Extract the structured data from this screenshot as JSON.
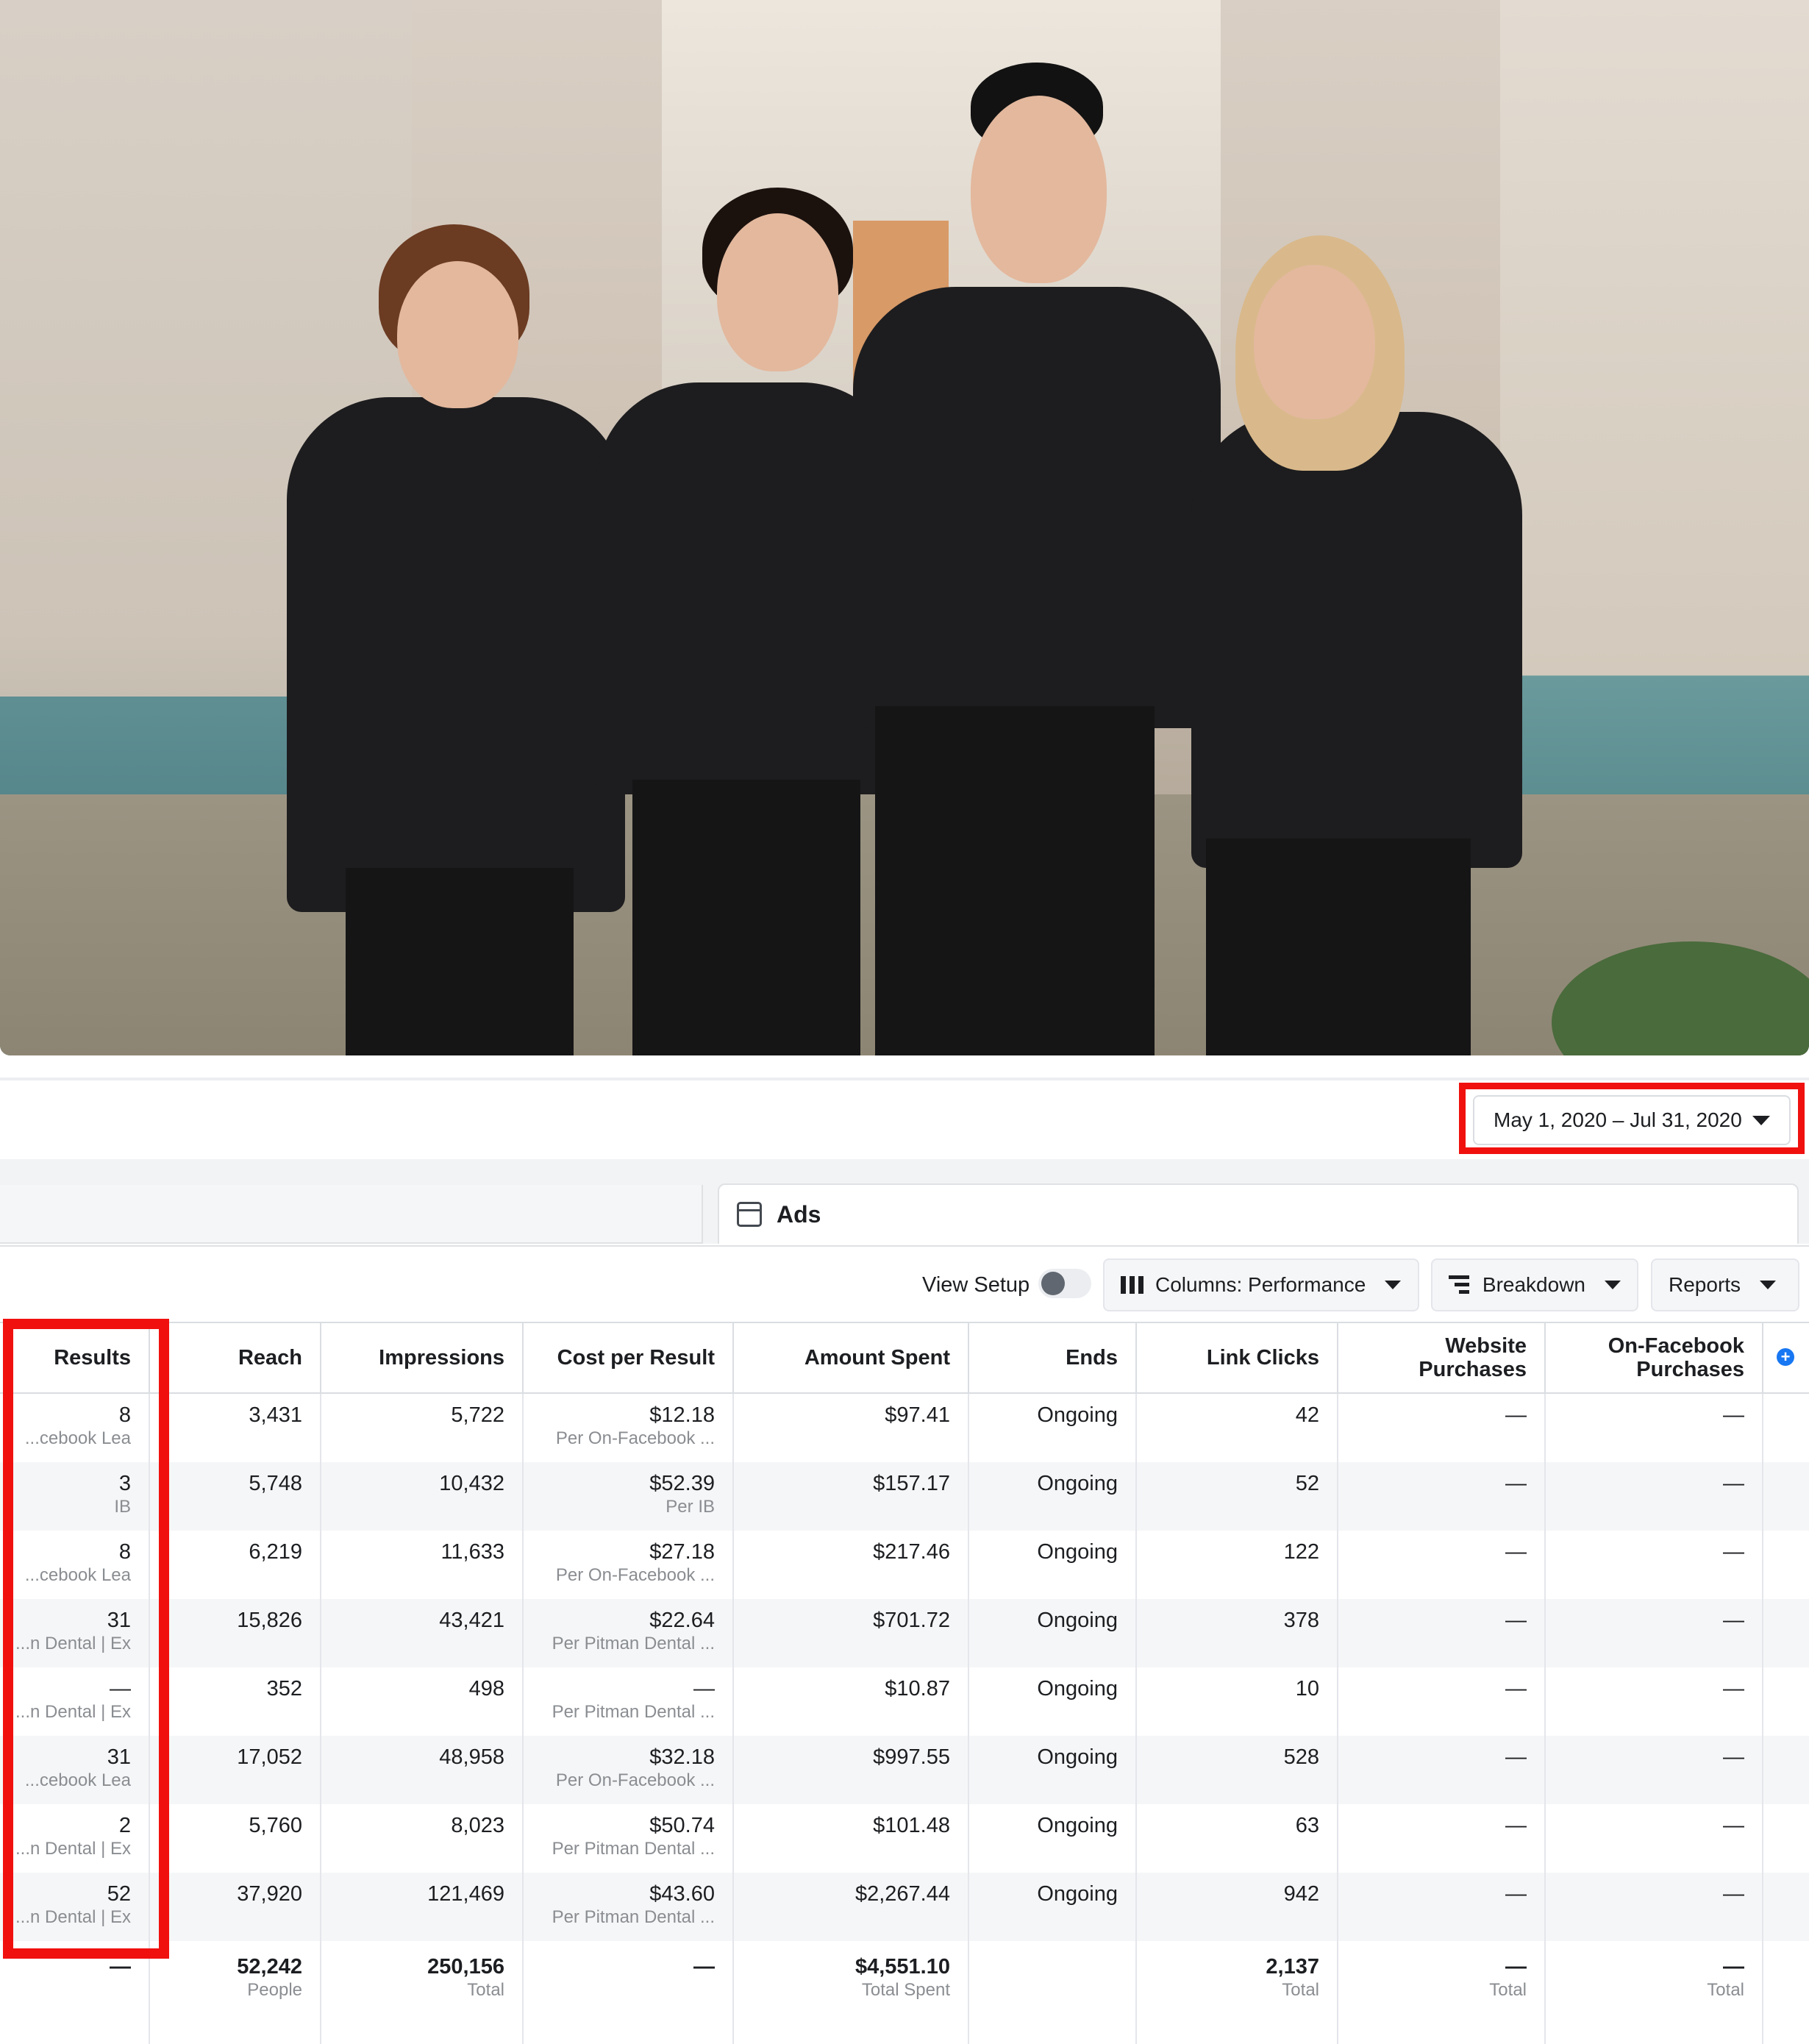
{
  "date_range": {
    "label": "May 1, 2020 – Jul 31, 2020"
  },
  "ads_panel": {
    "label": "Ads"
  },
  "controls": {
    "view_setup": "View Setup",
    "columns": "Columns: Performance",
    "breakdown": "Breakdown",
    "reports": "Reports"
  },
  "table": {
    "columns": [
      "Results",
      "Reach",
      "Impressions",
      "Cost per Result",
      "Amount Spent",
      "Ends",
      "Link Clicks",
      "Website Purchases",
      "On-Facebook Purchases"
    ],
    "rows": [
      {
        "results": "8",
        "results_sub": "cebook Lea...",
        "reach": "3,431",
        "impressions": "5,722",
        "cost": "$12.18",
        "cost_sub": "Per On-Facebook ...",
        "spent": "$97.41",
        "ends": "Ongoing",
        "clicks": "42",
        "web": "—",
        "onfb": "—"
      },
      {
        "results": "3",
        "results_sub": "IB",
        "reach": "5,748",
        "impressions": "10,432",
        "cost": "$52.39",
        "cost_sub": "Per IB",
        "spent": "$157.17",
        "ends": "Ongoing",
        "clicks": "52",
        "web": "—",
        "onfb": "—"
      },
      {
        "results": "8",
        "results_sub": "cebook Lea...",
        "reach": "6,219",
        "impressions": "11,633",
        "cost": "$27.18",
        "cost_sub": "Per On-Facebook ...",
        "spent": "$217.46",
        "ends": "Ongoing",
        "clicks": "122",
        "web": "—",
        "onfb": "—"
      },
      {
        "results": "31",
        "results_sub": "n Dental | Ex...",
        "reach": "15,826",
        "impressions": "43,421",
        "cost": "$22.64",
        "cost_sub": "Per Pitman Dental ...",
        "spent": "$701.72",
        "ends": "Ongoing",
        "clicks": "378",
        "web": "—",
        "onfb": "—"
      },
      {
        "results": "—",
        "results_sub": "n Dental | Ex...",
        "reach": "352",
        "impressions": "498",
        "cost": "—",
        "cost_sub": "Per Pitman Dental ...",
        "spent": "$10.87",
        "ends": "Ongoing",
        "clicks": "10",
        "web": "—",
        "onfb": "—"
      },
      {
        "results": "31",
        "results_sub": "cebook Lea...",
        "reach": "17,052",
        "impressions": "48,958",
        "cost": "$32.18",
        "cost_sub": "Per On-Facebook ...",
        "spent": "$997.55",
        "ends": "Ongoing",
        "clicks": "528",
        "web": "—",
        "onfb": "—"
      },
      {
        "results": "2",
        "results_sub": "n Dental | Ex...",
        "reach": "5,760",
        "impressions": "8,023",
        "cost": "$50.74",
        "cost_sub": "Per Pitman Dental ...",
        "spent": "$101.48",
        "ends": "Ongoing",
        "clicks": "63",
        "web": "—",
        "onfb": "—"
      },
      {
        "results": "52",
        "results_sub": "n Dental | Ex...",
        "reach": "37,920",
        "impressions": "121,469",
        "cost": "$43.60",
        "cost_sub": "Per Pitman Dental ...",
        "spent": "$2,267.44",
        "ends": "Ongoing",
        "clicks": "942",
        "web": "—",
        "onfb": "—"
      }
    ],
    "totals": {
      "results": "—",
      "reach": "52,242",
      "reach_sub": "People",
      "impressions": "250,156",
      "impressions_sub": "Total",
      "cost": "—",
      "spent": "$4,551.10",
      "spent_sub": "Total Spent",
      "clicks": "2,137",
      "clicks_sub": "Total",
      "web": "—",
      "web_sub": "Total",
      "onfb": "—",
      "onfb_sub": "Total"
    }
  },
  "colors": {
    "highlight": "#f0110f",
    "accent": "#1877f2"
  },
  "icons": [
    "ads-calendar-icon",
    "columns-icon",
    "breakdown-icon",
    "chevron-down-icon",
    "add-column-icon"
  ]
}
